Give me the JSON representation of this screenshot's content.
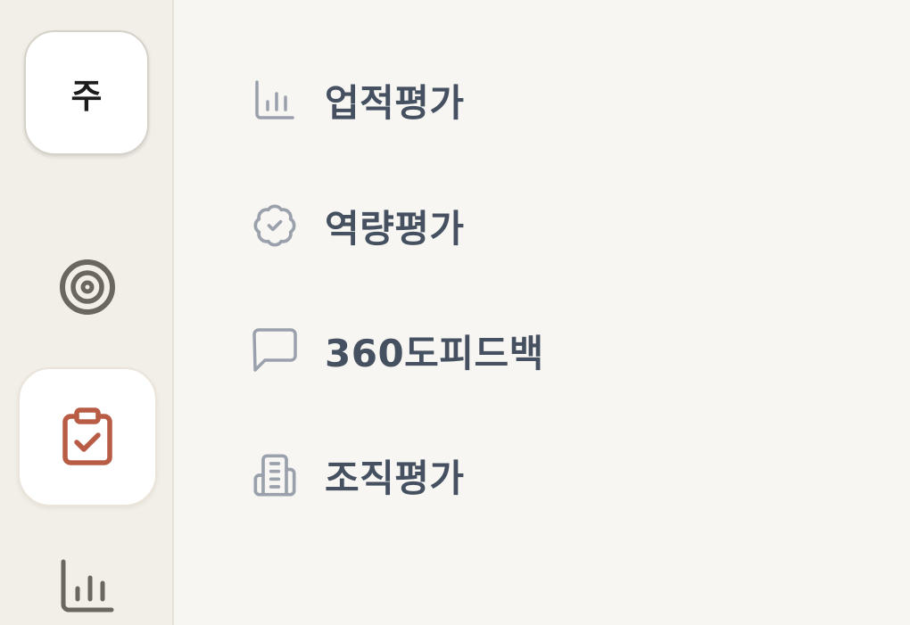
{
  "workspace": {
    "initial": "주"
  },
  "rail": {
    "items": [
      {
        "id": "goals",
        "icon": "target-icon",
        "active": false
      },
      {
        "id": "evaluation",
        "icon": "clipboard-check-icon",
        "active": true
      },
      {
        "id": "stats",
        "icon": "bar-chart-icon",
        "active": false
      }
    ],
    "active_color": "#b85c45",
    "icon_color": "#6b6660"
  },
  "submenu": {
    "icon_color": "#9aa1ad",
    "text_color": "#455061",
    "items": [
      {
        "label": "업적평가",
        "icon": "bar-chart-icon"
      },
      {
        "label": "역량평가",
        "icon": "badge-check-icon"
      },
      {
        "label": "360도피드백",
        "icon": "message-square-icon"
      },
      {
        "label": "조직평가",
        "icon": "building-icon"
      }
    ]
  }
}
